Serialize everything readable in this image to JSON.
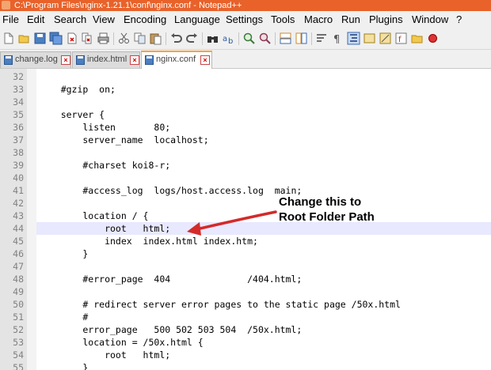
{
  "window": {
    "title": "C:\\Program Files\\nginx-1.21.1\\conf\\nginx.conf - Notepad++"
  },
  "menu": [
    "File",
    "Edit",
    "Search",
    "View",
    "Encoding",
    "Language",
    "Settings",
    "Tools",
    "Macro",
    "Run",
    "Plugins",
    "Window",
    "?"
  ],
  "toolbar": {
    "icons": [
      "new-file-icon",
      "open-file-icon",
      "save-icon",
      "save-all-icon",
      "close-icon",
      "close-all-icon",
      "print-icon",
      "cut-icon",
      "copy-icon",
      "paste-icon",
      "undo-icon",
      "redo-icon",
      "find-icon",
      "replace-icon",
      "zoom-in-icon",
      "zoom-out-icon",
      "sync-vertical-icon",
      "sync-horizontal-icon",
      "word-wrap-icon",
      "show-all-chars-icon",
      "indent-guide-icon",
      "language-icon",
      "doc-map-icon",
      "function-list-icon",
      "folder-workspace-icon",
      "record-macro-icon"
    ]
  },
  "tabs": [
    {
      "label": "change.log",
      "active": false
    },
    {
      "label": "index.html",
      "active": false
    },
    {
      "label": "nginx.conf",
      "active": true
    }
  ],
  "editor": {
    "current_line": "44",
    "lines": [
      {
        "num": "32",
        "text": ""
      },
      {
        "num": "33",
        "text": "    #gzip  on;"
      },
      {
        "num": "34",
        "text": ""
      },
      {
        "num": "35",
        "text": "    server {"
      },
      {
        "num": "36",
        "text": "        listen       80;"
      },
      {
        "num": "37",
        "text": "        server_name  localhost;"
      },
      {
        "num": "38",
        "text": ""
      },
      {
        "num": "39",
        "text": "        #charset koi8-r;"
      },
      {
        "num": "40",
        "text": ""
      },
      {
        "num": "41",
        "text": "        #access_log  logs/host.access.log  main;"
      },
      {
        "num": "42",
        "text": ""
      },
      {
        "num": "43",
        "text": "        location / {"
      },
      {
        "num": "44",
        "text": "            root   html;"
      },
      {
        "num": "45",
        "text": "            index  index.html index.htm;"
      },
      {
        "num": "46",
        "text": "        }"
      },
      {
        "num": "47",
        "text": ""
      },
      {
        "num": "48",
        "text": "        #error_page  404              /404.html;"
      },
      {
        "num": "49",
        "text": ""
      },
      {
        "num": "50",
        "text": "        # redirect server error pages to the static page /50x.html"
      },
      {
        "num": "51",
        "text": "        #"
      },
      {
        "num": "52",
        "text": "        error_page   500 502 503 504  /50x.html;"
      },
      {
        "num": "53",
        "text": "        location = /50x.html {"
      },
      {
        "num": "54",
        "text": "            root   html;"
      },
      {
        "num": "55",
        "text": "        }"
      }
    ]
  },
  "annotation": {
    "line1": "Change this to",
    "line2": "Root Folder Path",
    "color": "#d42a2a"
  }
}
